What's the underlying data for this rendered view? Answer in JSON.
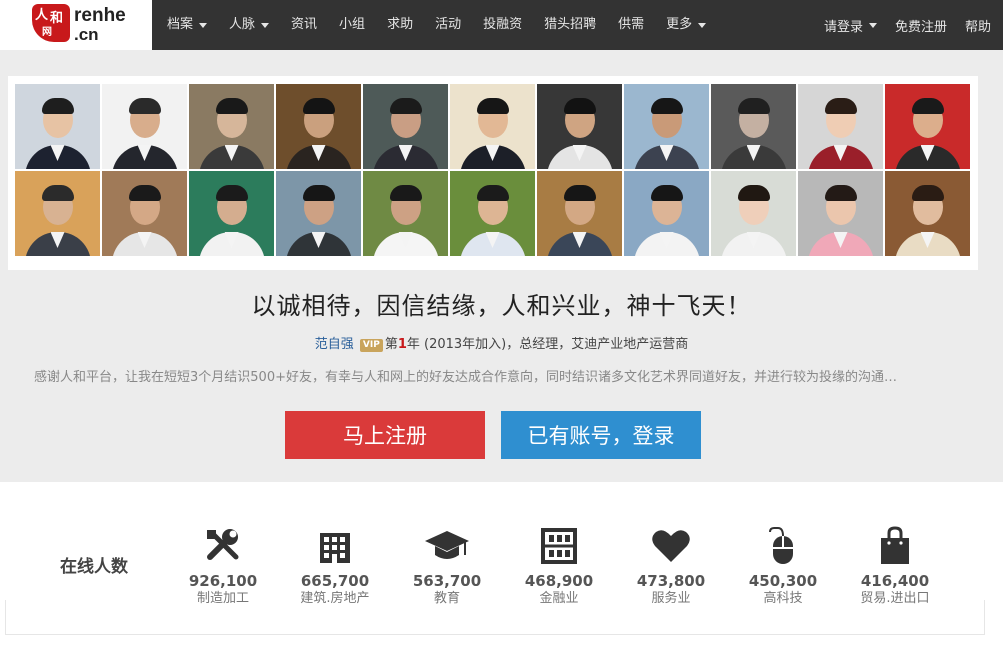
{
  "logo": {
    "seal_chars": [
      "人",
      "和",
      "网"
    ],
    "brand": "renhe",
    "domain": ".cn"
  },
  "nav": {
    "items": [
      {
        "label": "档案",
        "dropdown": true
      },
      {
        "label": "人脉",
        "dropdown": true
      },
      {
        "label": "资讯",
        "dropdown": false
      },
      {
        "label": "小组",
        "dropdown": false
      },
      {
        "label": "求助",
        "dropdown": false
      },
      {
        "label": "活动",
        "dropdown": false
      },
      {
        "label": "投融资",
        "dropdown": false
      },
      {
        "label": "猎头招聘",
        "dropdown": false
      },
      {
        "label": "供需",
        "dropdown": false
      },
      {
        "label": "更多",
        "dropdown": true
      }
    ],
    "right": {
      "login": "请登录",
      "register": "免费注册",
      "help": "帮助"
    }
  },
  "hero": {
    "slogan": "以诚相待，因信结缘，人和兴业，神十飞天！",
    "testimonial": {
      "name": "范自强",
      "vip": "VIP",
      "year_prefix": "第",
      "year_num": "1",
      "year_suffix": "年",
      "joined": "(2013年加入)，总经理，艾迪产业地产运营商"
    },
    "quote": "感谢人和平台，让我在短短3个月结识500+好友，有幸与人和网上的好友达成合作意向，同时结识诸多文化艺术界同道好友，并进行较为投缘的沟通…",
    "register_button": "马上注册",
    "login_button": "已有账号，登录"
  },
  "photos": [
    {
      "bg": "#cfd6de",
      "skin": "#e7c3a4",
      "hair": "#1e1e1e",
      "suit": "#1d2230"
    },
    {
      "bg": "#f2f2f2",
      "skin": "#d8ad8c",
      "hair": "#2a2a2a",
      "suit": "#24262d"
    },
    {
      "bg": "#8a7a62",
      "skin": "#d6b69a",
      "hair": "#191919",
      "suit": "#3a3a3a"
    },
    {
      "bg": "#6e4e2c",
      "skin": "#caa07e",
      "hair": "#141414",
      "suit": "#2a2420"
    },
    {
      "bg": "#4e5a58",
      "skin": "#c99e84",
      "hair": "#1b1b1b",
      "suit": "#2b2b33"
    },
    {
      "bg": "#ece2cc",
      "skin": "#e2b895",
      "hair": "#161616",
      "suit": "#1c1f28"
    },
    {
      "bg": "#373737",
      "skin": "#cfa482",
      "hair": "#121212",
      "suit": "#e4e4e4"
    },
    {
      "bg": "#9bb7cf",
      "skin": "#c99a78",
      "hair": "#161616",
      "suit": "#3c4250"
    },
    {
      "bg": "#5a5a5a",
      "skin": "#c4b0a2",
      "hair": "#202020",
      "suit": "#3a3a3a"
    },
    {
      "bg": "#d6d6d6",
      "skin": "#efcdb4",
      "hair": "#2a1d16",
      "suit": "#9a1f2a"
    },
    {
      "bg": "#c92a2a",
      "skin": "#dcae8c",
      "hair": "#1a1a1a",
      "suit": "#2a2a2a"
    },
    {
      "bg": "#d9a25a",
      "skin": "#d8b292",
      "hair": "#2b2b2b",
      "suit": "#3a3f48"
    },
    {
      "bg": "#a07a58",
      "skin": "#d4a886",
      "hair": "#1a1a1a",
      "suit": "#e6e6e6"
    },
    {
      "bg": "#2c7c5c",
      "skin": "#d4ad8f",
      "hair": "#1b1b1b",
      "suit": "#f2f2f2"
    },
    {
      "bg": "#7d96a8",
      "skin": "#cda184",
      "hair": "#161616",
      "suit": "#2f3438"
    },
    {
      "bg": "#6f8a44",
      "skin": "#cda184",
      "hair": "#191919",
      "suit": "#f5f5f5"
    },
    {
      "bg": "#6a8e3c",
      "skin": "#ddb594",
      "hair": "#1b1b1b",
      "suit": "#dfe6f0"
    },
    {
      "bg": "#a87c44",
      "skin": "#d3a884",
      "hair": "#161616",
      "suit": "#3a4658"
    },
    {
      "bg": "#8aa8c4",
      "skin": "#dcb496",
      "hair": "#161616",
      "suit": "#f3f3f3"
    },
    {
      "bg": "#d8dcd6",
      "skin": "#efcfba",
      "hair": "#201812",
      "suit": "#f2f2f2"
    },
    {
      "bg": "#b8b8b8",
      "skin": "#ebc6ad",
      "hair": "#231a16",
      "suit": "#f0a8b8"
    },
    {
      "bg": "#8a5a34",
      "skin": "#e1bc9e",
      "hair": "#2a1c14",
      "suit": "#e9dcc4"
    }
  ],
  "stats": {
    "online_label": "在线人数",
    "items": [
      {
        "icon": "tools-icon",
        "value": "926,100",
        "label": "制造加工"
      },
      {
        "icon": "building-icon",
        "value": "665,700",
        "label": "建筑.房地产"
      },
      {
        "icon": "graduation-cap-icon",
        "value": "563,700",
        "label": "教育"
      },
      {
        "icon": "abacus-icon",
        "value": "468,900",
        "label": "金融业"
      },
      {
        "icon": "heart-icon",
        "value": "473,800",
        "label": "服务业"
      },
      {
        "icon": "mouse-icon",
        "value": "450,300",
        "label": "高科技"
      },
      {
        "icon": "shopping-bag-icon",
        "value": "416,400",
        "label": "贸易.进出口"
      }
    ]
  },
  "colors": {
    "topbar": "#333333",
    "brand_red": "#c8191b",
    "register_button": "#da3a3a",
    "login_button": "#2f8fd0",
    "hero_bg": "#ececec"
  }
}
